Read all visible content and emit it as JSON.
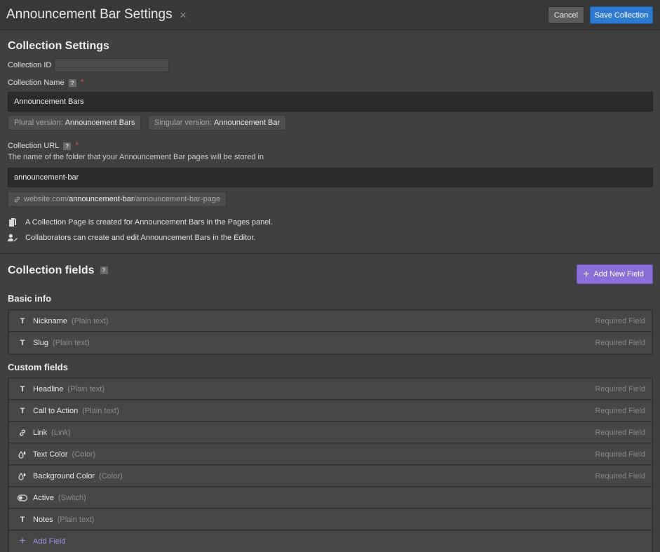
{
  "header": {
    "title": "Announcement Bar Settings",
    "close_glyph": "×",
    "cancel_label": "Cancel",
    "save_label": "Save Collection"
  },
  "settings": {
    "heading": "Collection Settings",
    "id_label": "Collection ID",
    "id_value": "",
    "name_label": "Collection Name",
    "help_glyph": "?",
    "required_glyph": "*",
    "name_value": "Announcement Bars",
    "plural_prefix": "Plural version:",
    "plural_value": "Announcement Bars",
    "singular_prefix": "Singular version:",
    "singular_value": "Announcement Bar",
    "url_label": "Collection URL",
    "url_desc": "The name of the folder that your Announcement Bar pages will be stored in",
    "url_value": "announcement-bar",
    "url_preview_prefix": "website.com/",
    "url_preview_slug": "announcement-bar",
    "url_preview_suffix": "/announcement-bar-page",
    "note_pages": "A Collection Page is created for Announcement Bars in the Pages panel.",
    "note_editor": "Collaborators can create and edit Announcement Bars in the Editor."
  },
  "fields": {
    "heading": "Collection fields",
    "add_new_label": "Add New Field",
    "basic_heading": "Basic info",
    "custom_heading": "Custom fields",
    "required_label": "Required Field",
    "basic": [
      {
        "icon": "text-icon",
        "glyph": "T",
        "name": "Nickname",
        "type": "(Plain text)",
        "required": true
      },
      {
        "icon": "text-icon",
        "glyph": "T",
        "name": "Slug",
        "type": "(Plain text)",
        "required": true
      }
    ],
    "custom": [
      {
        "icon": "text-icon",
        "glyph": "T",
        "name": "Headline",
        "type": "(Plain text)",
        "required": true
      },
      {
        "icon": "text-icon",
        "glyph": "T",
        "name": "Call to Action",
        "type": "(Plain text)",
        "required": true
      },
      {
        "icon": "link-icon",
        "glyph": "",
        "name": "Link",
        "type": "(Link)",
        "required": true
      },
      {
        "icon": "color-drop-icon",
        "glyph": "",
        "name": "Text Color",
        "type": "(Color)",
        "required": true
      },
      {
        "icon": "color-drop-icon",
        "glyph": "",
        "name": "Background Color",
        "type": "(Color)",
        "required": true
      },
      {
        "icon": "switch-icon",
        "glyph": "",
        "name": "Active",
        "type": "(Switch)",
        "required": false
      },
      {
        "icon": "text-icon",
        "glyph": "T",
        "name": "Notes",
        "type": "(Plain text)",
        "required": false
      }
    ],
    "add_field_label": "Add Field"
  }
}
